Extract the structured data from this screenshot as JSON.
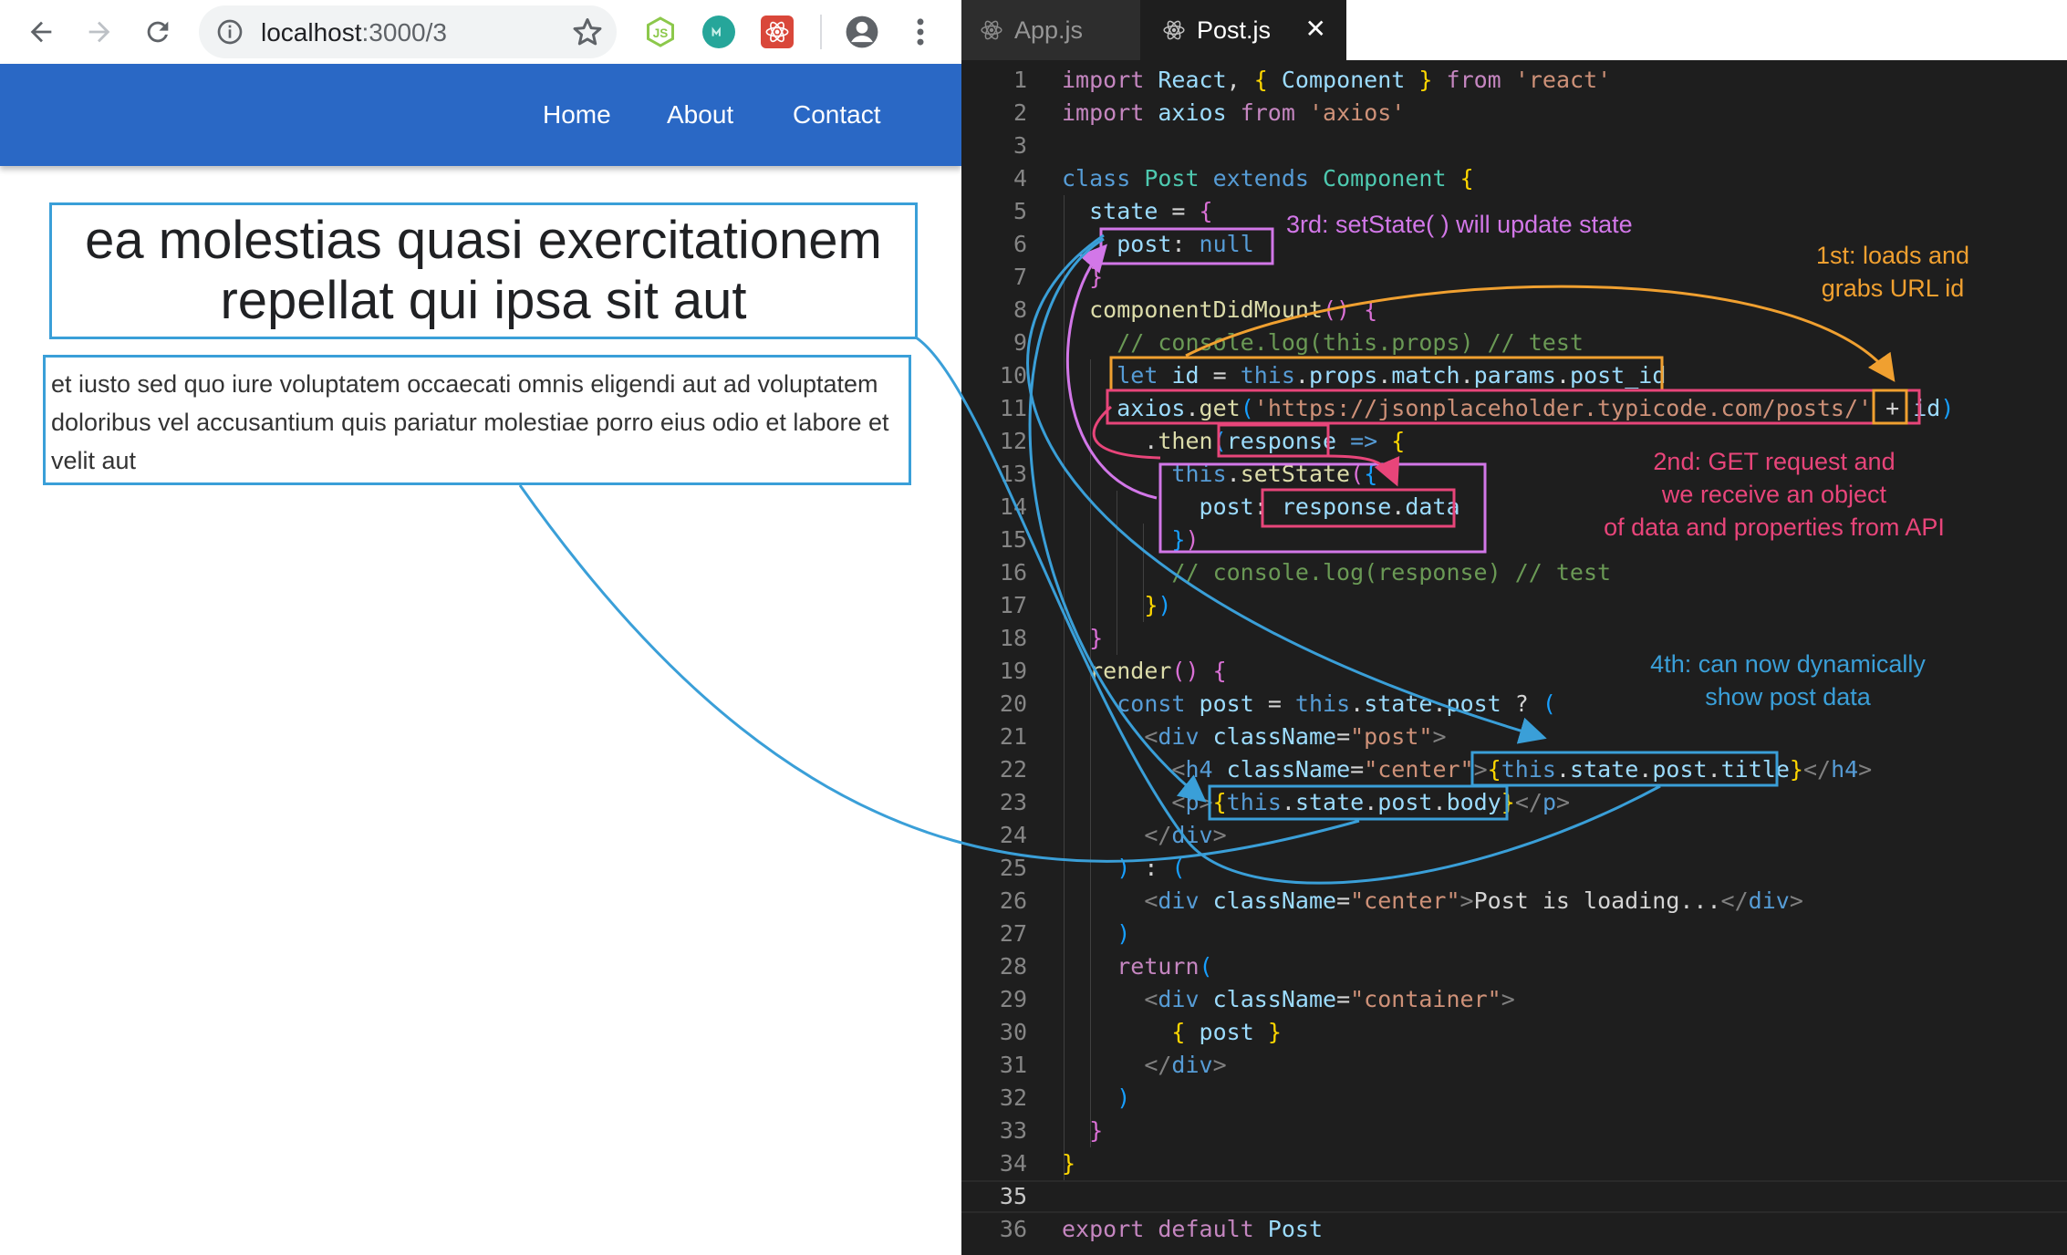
{
  "browser": {
    "url_host": "localhost",
    "url_path": ":3000/3",
    "extensions": [
      "nodejs-extension-icon",
      "m-extension-icon",
      "react-devtools-icon"
    ],
    "navbar": {
      "links": [
        "Home",
        "About",
        "Contact"
      ],
      "color": "#2a68c5"
    },
    "post": {
      "title": "ea molestias quasi exercitationem repellat qui ipsa sit aut",
      "body": "et iusto sed quo iure voluptatem occaecati omnis eligendi aut ad voluptatem doloribus vel accusantium quis pariatur molestiae porro eius odio et labore et velit aut"
    }
  },
  "editor": {
    "tabs": [
      {
        "label": "App.js",
        "active": false
      },
      {
        "label": "Post.js",
        "active": true
      }
    ],
    "close_glyph": "✕",
    "line_numbers": [
      "1",
      "2",
      "3",
      "4",
      "5",
      "6",
      "7",
      "8",
      "9",
      "10",
      "11",
      "12",
      "13",
      "14",
      "15",
      "16",
      "17",
      "18",
      "19",
      "20",
      "21",
      "22",
      "23",
      "24",
      "25",
      "26",
      "27",
      "28",
      "29",
      "30",
      "31",
      "32",
      "33",
      "34",
      "35",
      "36"
    ],
    "active_line": 35
  },
  "annotations": {
    "first": "1st: loads and\ngrabs URL id",
    "second": "2nd: GET request and\nwe receive an object\nof data and properties from API",
    "third": "3rd: setState( ) will update state",
    "fourth": "4th: can now dynamically\nshow post data",
    "colors": {
      "orange": "#f0a030",
      "pink": "#e8457a",
      "purple": "#d277e8",
      "blue": "#3a9fd8"
    }
  }
}
